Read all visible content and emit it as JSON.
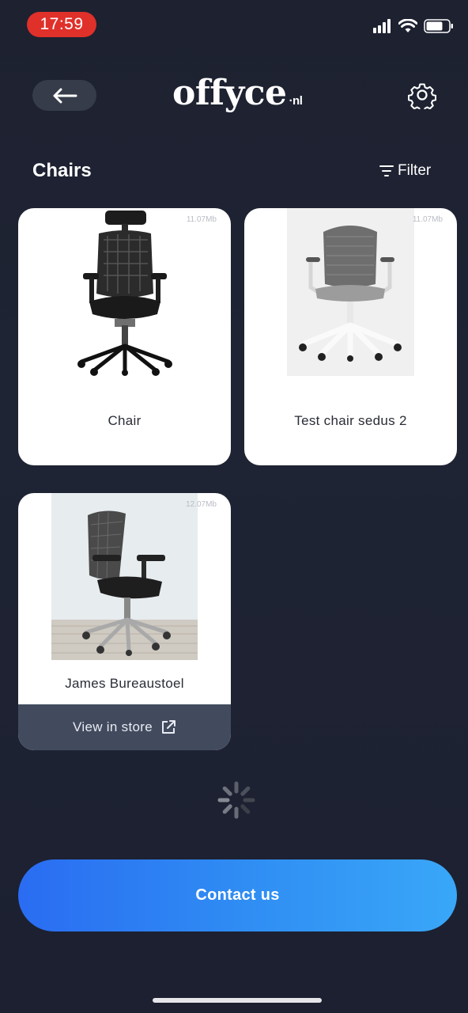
{
  "status_bar": {
    "time": "17:59"
  },
  "header": {
    "logo_main": "offyce",
    "logo_suffix": "·nl",
    "icons": {
      "back": "arrow-left-icon",
      "settings": "gear-icon"
    }
  },
  "section": {
    "title": "Chairs",
    "filter_label": "Filter"
  },
  "products": [
    {
      "name": "Chair",
      "size": "11.07Mb",
      "image": "black-mesh-office-chair"
    },
    {
      "name": "Test chair sedus 2",
      "size": "11.07Mb",
      "image": "grey-mesh-office-chair"
    },
    {
      "name": "James Bureaustoel",
      "size": "12.07Mb",
      "image": "black-mesh-chair-room",
      "store_label": "View in store"
    }
  ],
  "footer": {
    "contact_label": "Contact us"
  },
  "colors": {
    "background": "#1d2130",
    "time_pill": "#e0302a",
    "store_bar": "#424b5e",
    "contact_gradient_start": "#2a6cf2",
    "contact_gradient_end": "#39a7f8"
  }
}
